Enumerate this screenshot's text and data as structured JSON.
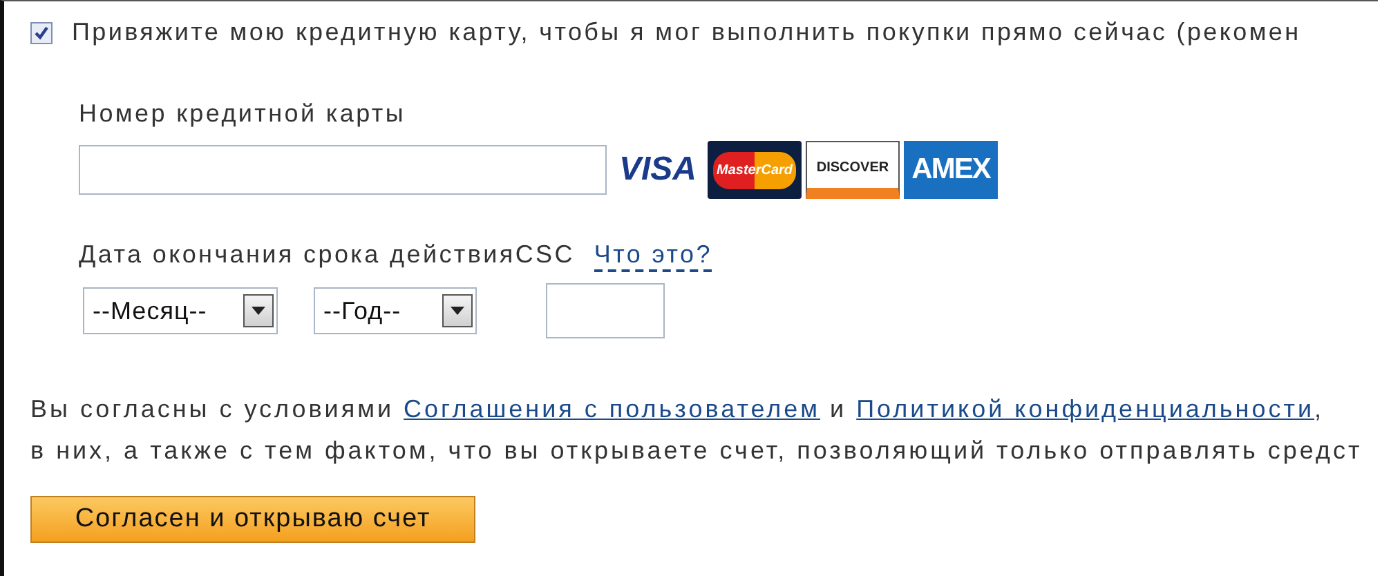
{
  "link_card": {
    "label": "Привяжите мою кредитную карту, чтобы я мог выполнить покупки прямо сейчас (рекомен",
    "checked": true
  },
  "card_number": {
    "label": "Номер кредитной карты"
  },
  "card_logos": [
    {
      "kind": "visa",
      "text": "VISA"
    },
    {
      "kind": "mastercard",
      "text": "MasterCard"
    },
    {
      "kind": "discover",
      "text": "DISCOVER"
    },
    {
      "kind": "amex",
      "text": "AMEX"
    }
  ],
  "expiry": {
    "label": "Дата окончания срока действия",
    "month": "--Месяц--",
    "year": "--Год--"
  },
  "csc": {
    "label": "CSC",
    "help_link": "Что это?"
  },
  "legal": [
    [
      {
        "text": "Вы согласны с условиями ",
        "link": false
      },
      {
        "text": "Соглашения с пользователем",
        "link": true
      },
      {
        "text": " и ",
        "link": false
      },
      {
        "text": "Политикой конфиденциальности",
        "link": true
      },
      {
        "text": ",",
        "link": false
      }
    ],
    [
      {
        "text": "в них, а также с тем фактом, что вы открываете счет, позволяющий только отправлять средст",
        "link": false
      }
    ]
  ],
  "submit_button": "Согласен и открываю счет"
}
